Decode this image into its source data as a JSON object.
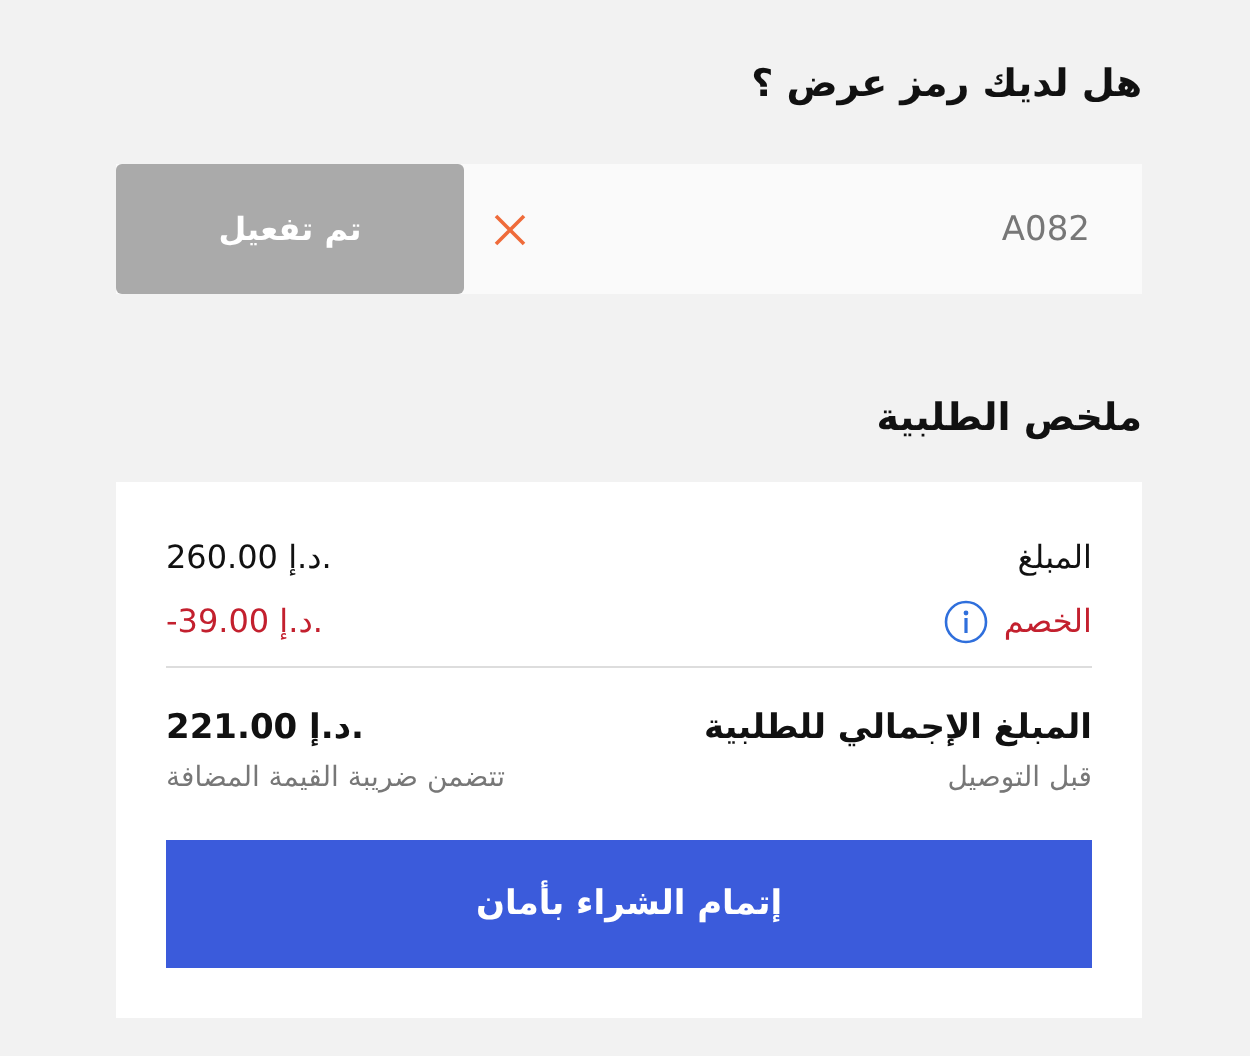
{
  "promo": {
    "title": "هل لديك رمز عرض ؟",
    "value": "A082",
    "button": "تم تفعيل",
    "applied": true
  },
  "summary": {
    "title": "ملخص الطلبية",
    "lines": [
      {
        "label": "المبلغ",
        "amount": "260.00 د.إ.",
        "kind": "plain"
      },
      {
        "label": "الخصم",
        "amount": "-39.00 د.إ.",
        "kind": "discount"
      }
    ],
    "total": {
      "label": "المبلغ الإجمالي للطلبية",
      "amount": "221.00 د.إ.",
      "note": "قبل التوصيل",
      "tax_note": "تتضمن ضريبة القيمة المضافة"
    },
    "checkout": "إتمام الشراء بأمان"
  }
}
